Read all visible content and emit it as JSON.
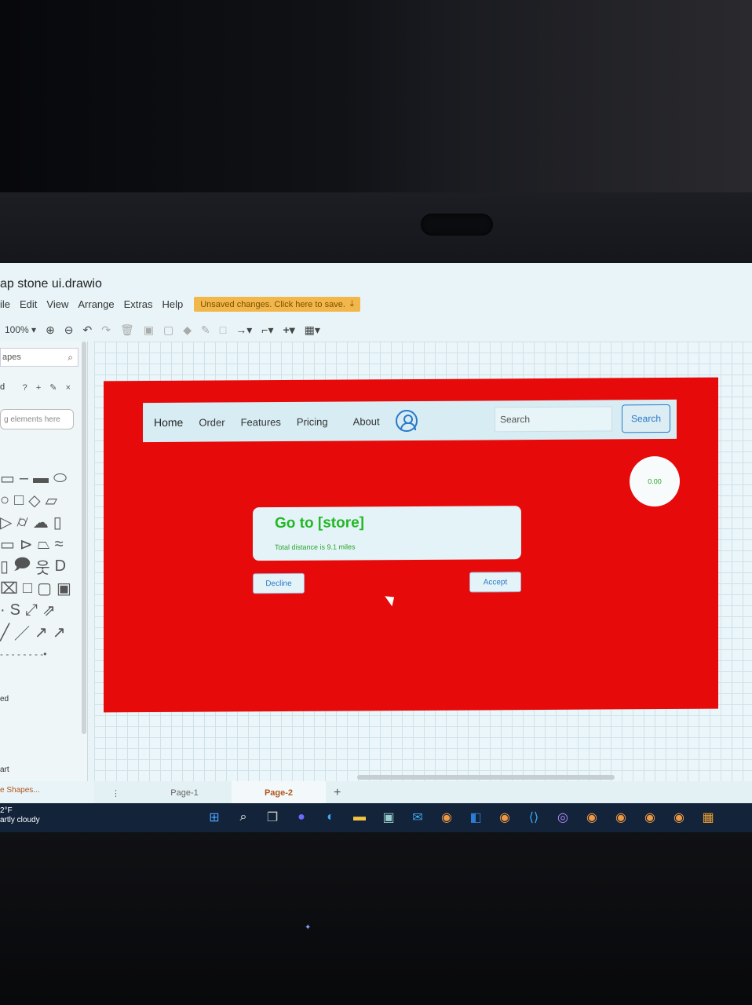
{
  "app": {
    "title": "ap stone ui.drawio",
    "menu": [
      "ile",
      "Edit",
      "View",
      "Arrange",
      "Extras",
      "Help"
    ],
    "save_banner": "Unsaved changes. Click here to save."
  },
  "toolbar": {
    "zoom": "100%"
  },
  "sidebar": {
    "search_placeholder": "apes",
    "section_label": "d",
    "section_icons": "? + ✎ ×",
    "drop_hint": "g elements here",
    "footer_label_1": "ed",
    "footer_label_2": "art",
    "more_shapes": "e Shapes..."
  },
  "mockup": {
    "nav": [
      "Home",
      "Order",
      "Features",
      "Pricing",
      "About"
    ],
    "search_placeholder": "Search",
    "search_button": "Search",
    "price": "0.00",
    "card_title": "Go to [store]",
    "card_subtitle": "Total distance is 9.1 miles",
    "decline": "Decline",
    "accept": "Accept"
  },
  "pages": {
    "page1": "Page-1",
    "page2": "Page-2",
    "add": "+"
  },
  "taskbar": {
    "temp": "2°F",
    "weather": "artly cloudy"
  },
  "colors": {
    "mockup_bg": "#e60a0a",
    "accent_blue": "#2a78c8",
    "accent_green": "#23b823",
    "save_banner": "#f2b64a"
  }
}
